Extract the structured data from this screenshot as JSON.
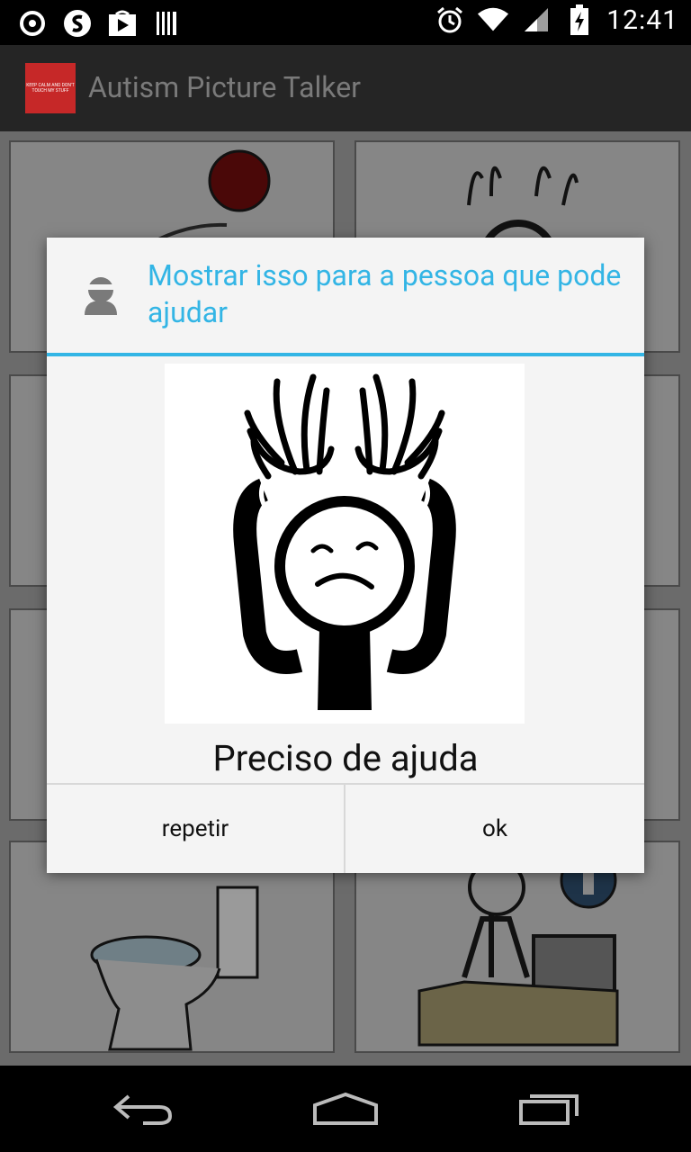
{
  "status_bar": {
    "time": "12:41",
    "left_icons": [
      "sync-icon",
      "s-app-icon",
      "play-store-icon",
      "barcode-icon"
    ],
    "right_icons": [
      "alarm-icon",
      "wifi-icon",
      "signal-icon",
      "battery-charging-icon"
    ]
  },
  "action_bar": {
    "title": "Autism Picture Talker",
    "logo_text": "KEEP CALM AND DON'T TOUCH MY STUFF"
  },
  "grid": {
    "cells": [
      {
        "picture": "stop-picture"
      },
      {
        "picture": "help-picture"
      },
      {
        "picture": "picture"
      },
      {
        "picture": "picture"
      },
      {
        "picture": "picture"
      },
      {
        "picture": "picture"
      },
      {
        "picture": "toilet-picture"
      },
      {
        "picture": "information-desk-picture"
      }
    ]
  },
  "dialog": {
    "title": "Mostrar isso para a pessoa que pode ajudar",
    "icon": "person-icon",
    "picture": "help-picture",
    "caption": "Preciso de ajuda",
    "buttons": {
      "repeat": "repetir",
      "ok": "ok"
    }
  },
  "nav_bar": {
    "buttons": [
      "back-icon",
      "home-icon",
      "recent-apps-icon"
    ]
  },
  "colors": {
    "accent": "#33b5e5",
    "dialog_bg": "#f4f4f4",
    "action_bar_bg": "#252525",
    "dim_overlay": "#6b6b6b"
  }
}
